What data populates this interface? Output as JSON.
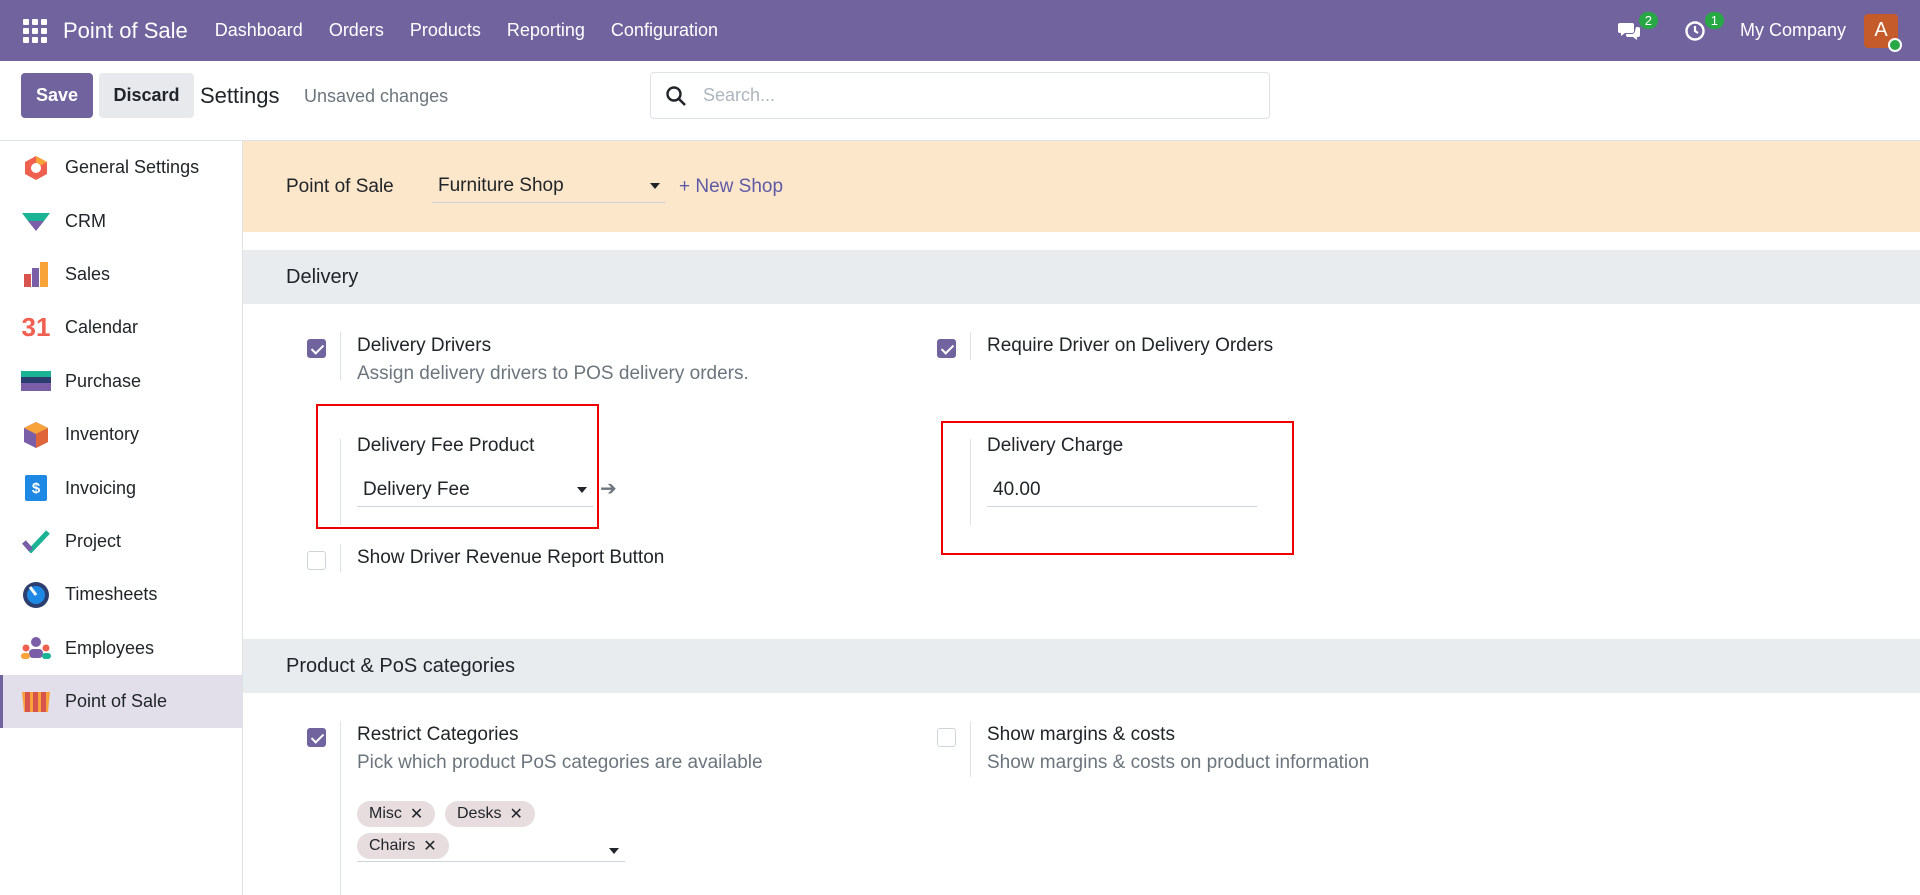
{
  "navbar": {
    "brand": "Point of Sale",
    "menu": [
      "Dashboard",
      "Orders",
      "Products",
      "Reporting",
      "Configuration"
    ],
    "messages_badge": "2",
    "activities_badge": "1",
    "company": "My Company",
    "avatar_letter": "A"
  },
  "control": {
    "save_label": "Save",
    "discard_label": "Discard",
    "title": "Settings",
    "status": "Unsaved changes",
    "search_placeholder": "Search..."
  },
  "sidebar": {
    "items": [
      {
        "label": "General Settings",
        "icon": "general-settings-icon"
      },
      {
        "label": "CRM",
        "icon": "crm-icon"
      },
      {
        "label": "Sales",
        "icon": "sales-icon"
      },
      {
        "label": "Calendar",
        "icon": "calendar-icon"
      },
      {
        "label": "Purchase",
        "icon": "purchase-icon"
      },
      {
        "label": "Inventory",
        "icon": "inventory-icon"
      },
      {
        "label": "Invoicing",
        "icon": "invoicing-icon"
      },
      {
        "label": "Project",
        "icon": "project-icon"
      },
      {
        "label": "Timesheets",
        "icon": "timesheets-icon"
      },
      {
        "label": "Employees",
        "icon": "employees-icon"
      },
      {
        "label": "Point of Sale",
        "icon": "point-of-sale-icon"
      }
    ],
    "active": "Point of Sale",
    "calendar_icon_text": "31",
    "invoicing_icon_text": "$"
  },
  "shop_bar": {
    "label": "Point of Sale",
    "selected_shop": "Furniture Shop",
    "new_shop_label": "+ New Shop"
  },
  "delivery": {
    "heading": "Delivery",
    "drivers": {
      "title": "Delivery Drivers",
      "desc": "Assign delivery drivers to POS delivery orders.",
      "checked": true
    },
    "require_driver": {
      "title": "Require Driver on Delivery Orders",
      "checked": true
    },
    "fee_product": {
      "title": "Delivery Fee Product",
      "value": "Delivery Fee"
    },
    "charge": {
      "title": "Delivery Charge",
      "value": "40.00"
    },
    "revenue_report": {
      "title": "Show Driver Revenue Report Button",
      "checked": false
    }
  },
  "categories": {
    "heading": "Product & PoS categories",
    "restrict": {
      "title": "Restrict Categories",
      "desc": "Pick which product PoS categories are available",
      "checked": true,
      "tags": [
        "Misc",
        "Desks",
        "Chairs"
      ]
    },
    "margins": {
      "title": "Show margins & costs",
      "desc": "Show margins & costs on product information",
      "checked": false
    }
  },
  "colors": {
    "brand": "#71639e",
    "shop_bar": "#fde7cb",
    "highlight": "#ee0000",
    "badge": "#28a745"
  }
}
